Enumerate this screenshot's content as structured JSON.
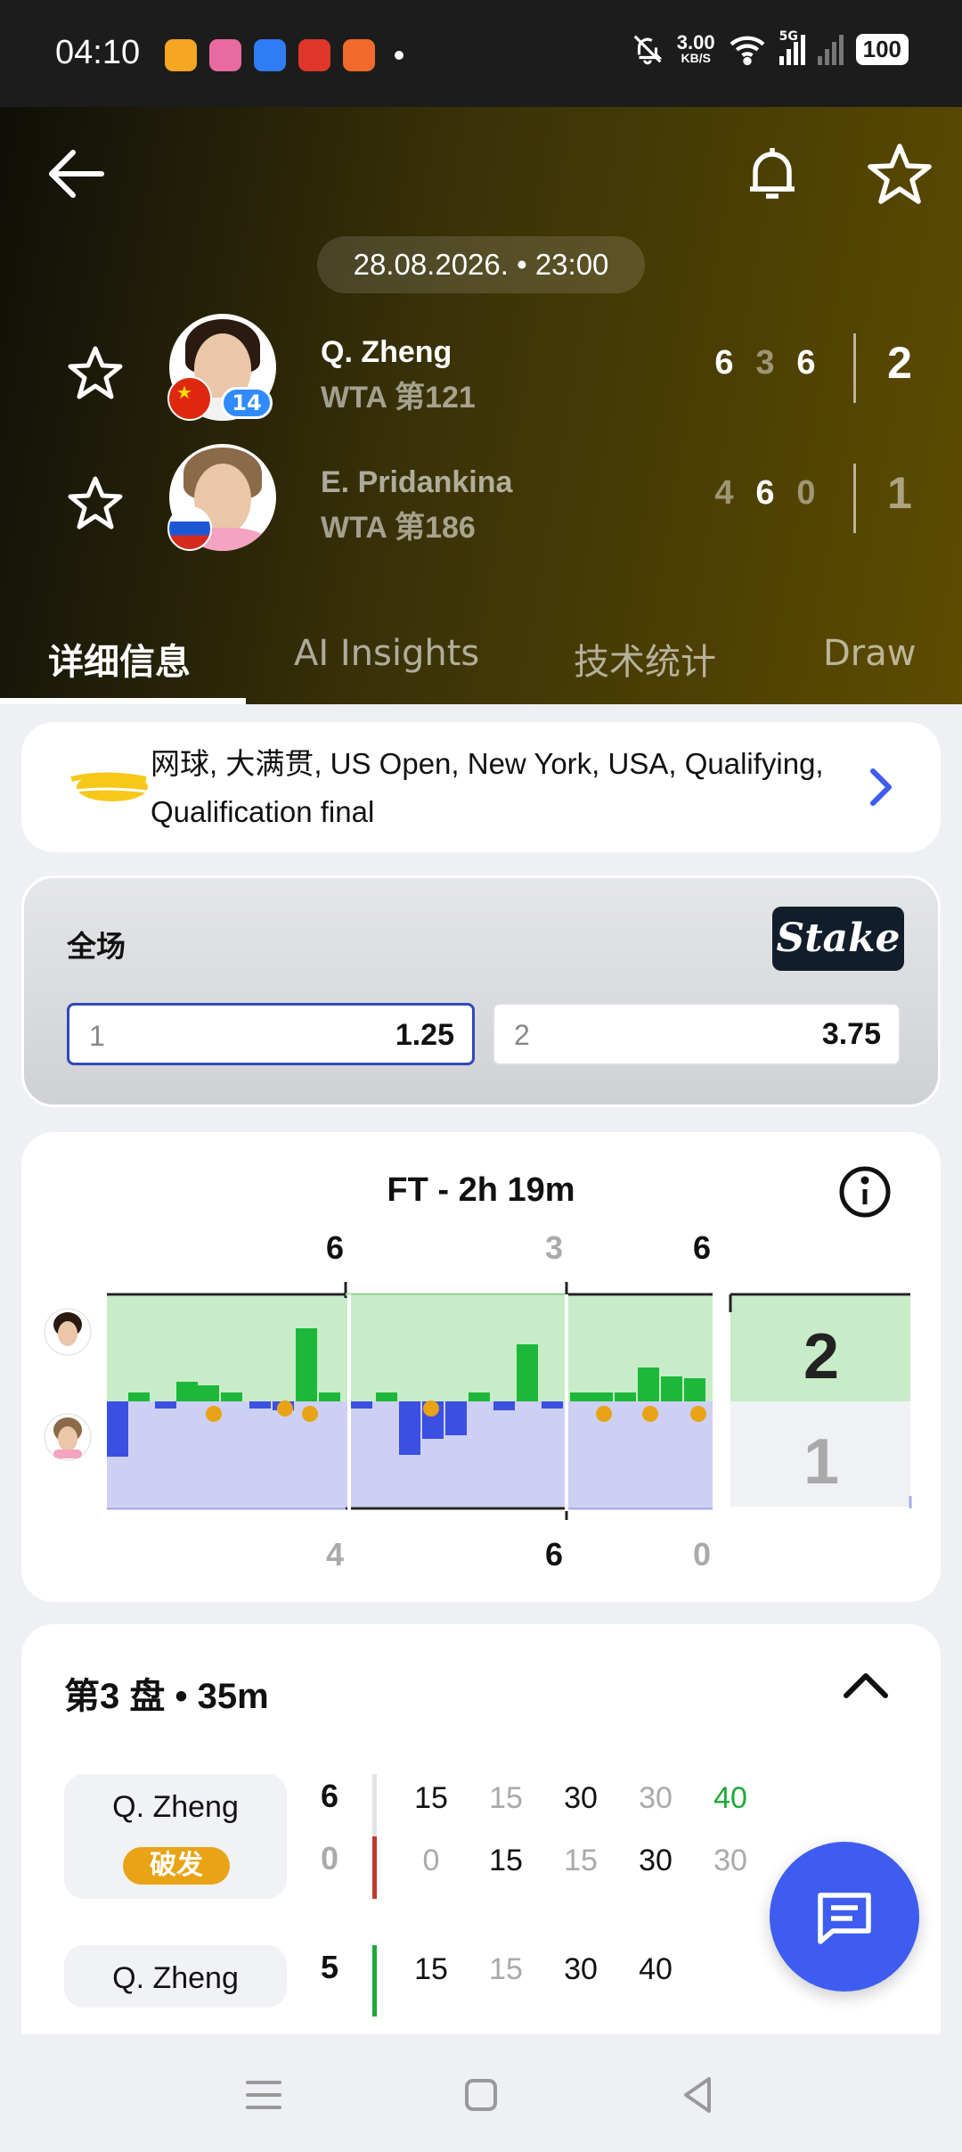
{
  "status": {
    "time": "04:10",
    "speed": "3.00",
    "speed_unit": "KB/S",
    "network": "5G",
    "battery": "100"
  },
  "match": {
    "datetime": "28.08.2026. • 23:00",
    "player1": {
      "name": "Q. Zheng",
      "rank": "WTA 第121",
      "seed": "14",
      "sets": [
        "6",
        "3",
        "6"
      ],
      "total": "2"
    },
    "player2": {
      "name": "E. Pridankina",
      "rank": "WTA 第186",
      "sets": [
        "4",
        "6",
        "0"
      ],
      "total": "1"
    }
  },
  "tabs": [
    {
      "label": "详细信息"
    },
    {
      "label": "AI Insights"
    },
    {
      "label": "技术统计"
    },
    {
      "label": "Draw"
    }
  ],
  "tournament": {
    "text": "网球, 大满贯, US Open, New York, USA, Qualifying, Qualification final"
  },
  "odds": {
    "title": "全场",
    "brand": "Stake",
    "options": [
      {
        "key": "1",
        "value": "1.25"
      },
      {
        "key": "2",
        "value": "3.75"
      }
    ]
  },
  "momentum": {
    "label": "FT - 2h 19m",
    "set_scores_top": [
      "6",
      "3",
      "6"
    ],
    "set_scores_bottom": [
      "4",
      "6",
      "0"
    ],
    "total_top": "2",
    "total_bottom": "1"
  },
  "set3": {
    "title": "第3 盘 • 35m",
    "games": [
      {
        "server": "Q. Zheng",
        "badge": "破发",
        "score_top": "6",
        "score_bottom": "0",
        "points_top": [
          "15",
          "15",
          "30",
          "30",
          "40"
        ],
        "points_bottom": [
          "0",
          "15",
          "15",
          "30",
          "30"
        ]
      },
      {
        "server": "Q. Zheng",
        "score_top": "5",
        "points_top": [
          "15",
          "15",
          "30",
          "40"
        ]
      }
    ]
  },
  "colors": {
    "accent": "#3e5df0",
    "p1_area": "#c8ecc8",
    "p2_area": "#cdd0f2",
    "win_bar": "#1db83a",
    "loss_bar": "#3b4fe0",
    "break_badge": "#e8a316"
  }
}
